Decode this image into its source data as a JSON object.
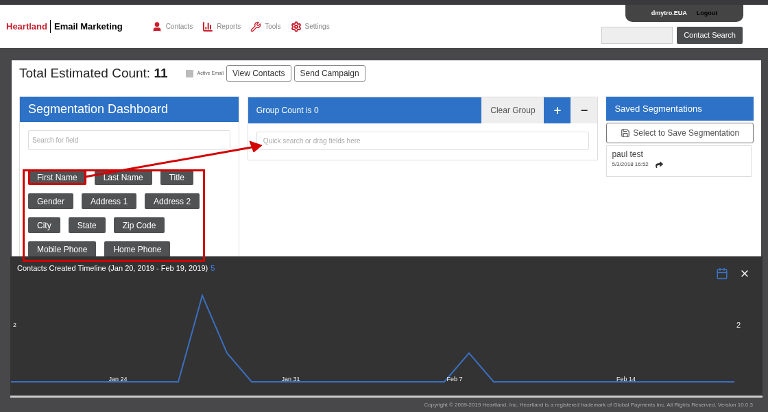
{
  "header": {
    "brand": "Heartland",
    "product": "Email Marketing",
    "nav": [
      {
        "kind": "person",
        "label": "Contacts"
      },
      {
        "kind": "chart",
        "label": "Reports"
      },
      {
        "kind": "wrench",
        "label": "Tools"
      },
      {
        "kind": "gear",
        "label": "Settings"
      }
    ],
    "user": "dmytro.EUA",
    "logout": "Logout",
    "search_button": "Contact Search"
  },
  "toolbar": {
    "count_label": "Total Estimated Count:",
    "count": "11",
    "active_email": {
      "label": "Active Email",
      "checked": false
    },
    "buttons": [
      "View Contacts",
      "Send Campaign"
    ]
  },
  "segmentation": {
    "title": "Segmentation Dashboard",
    "search_placeholder": "Search for field",
    "fields": [
      {
        "label": "First Name",
        "selected": true
      },
      {
        "label": "Last Name",
        "selected": false
      },
      {
        "label": "Title",
        "selected": false
      },
      {
        "label": "Gender",
        "selected": false
      },
      {
        "label": "Address 1",
        "selected": false
      },
      {
        "label": "Address 2",
        "selected": false
      },
      {
        "label": "City",
        "selected": false
      },
      {
        "label": "State",
        "selected": false
      },
      {
        "label": "Zip Code",
        "selected": false
      },
      {
        "label": "Mobile Phone",
        "selected": false
      },
      {
        "label": "Home Phone",
        "selected": false
      }
    ]
  },
  "group": {
    "title": "Group Count is 0",
    "clear": "Clear Group",
    "add": "+",
    "remove": "−",
    "placeholder": "Quick search or drag fields here"
  },
  "saved": {
    "title": "Saved Segmentations",
    "save_button": "Select to Save Segmentation",
    "items": [
      {
        "name": "paul test",
        "date": "5/3/2018 16:52"
      }
    ]
  },
  "timeline": {
    "title": "Contacts Created Timeline (Jan 20, 2019 - Feb 19, 2019)",
    "total": "5",
    "left_axis_label": "2",
    "right_axis_label": "2",
    "date_labels": [
      "Jan 24",
      "Jan 31",
      "Feb 7",
      "Feb 14"
    ]
  },
  "footer": "Copyright © 2009-2019 Heartland, Inc. Heartland is a registered trademark of Global Payments Inc. All Rights Reserved. Version 10.0.3"
}
